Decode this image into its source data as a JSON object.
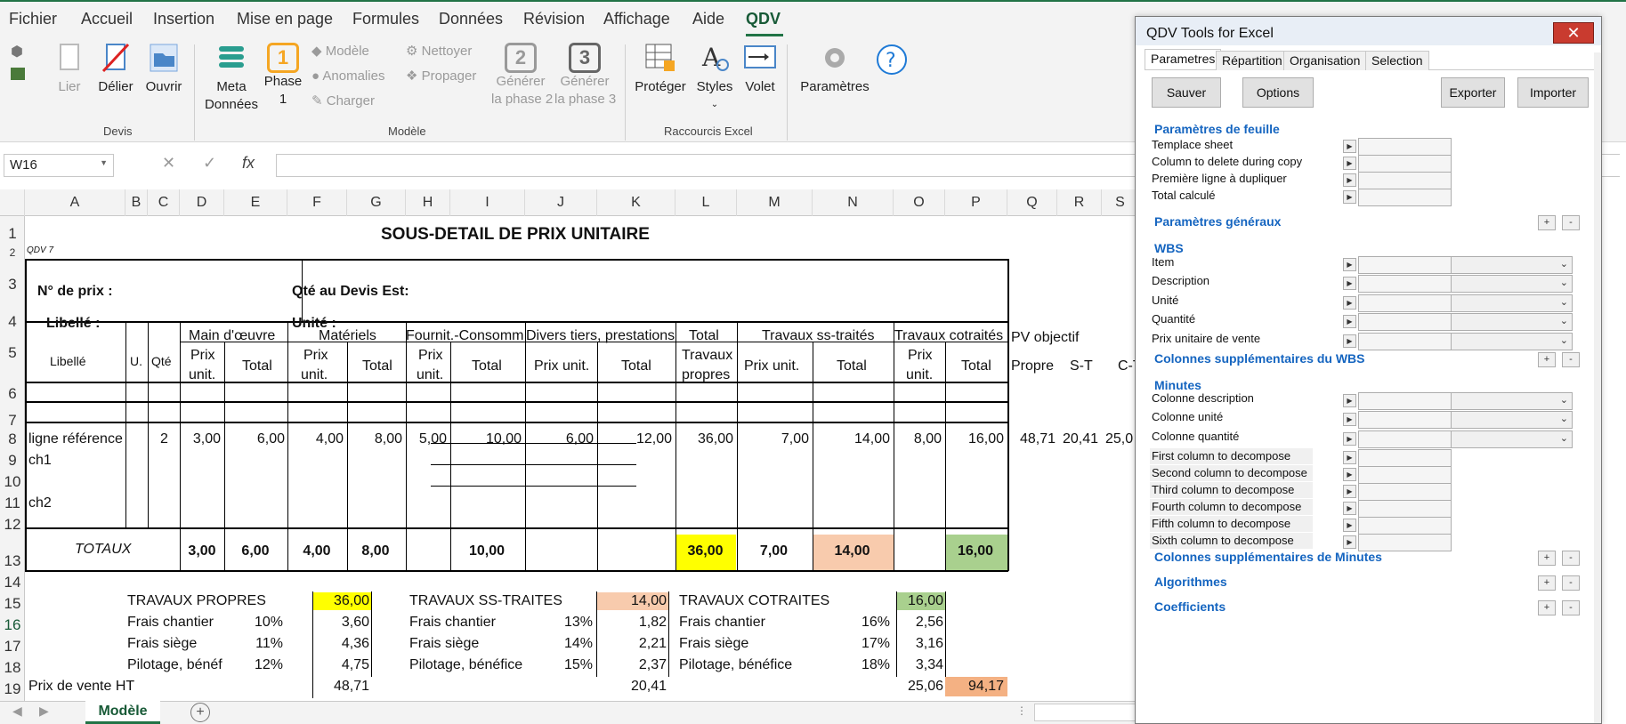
{
  "menu": {
    "items": [
      "Fichier",
      "Accueil",
      "Insertion",
      "Mise en page",
      "Formules",
      "Données",
      "Révision",
      "Affichage",
      "Aide",
      "QDV"
    ],
    "active": "QDV"
  },
  "ribbon": {
    "devis": {
      "lier": "Lier",
      "delier": "Délier",
      "ouvrir": "Ouvrir",
      "group": "Devis"
    },
    "modele": {
      "meta1": "Meta",
      "meta2": "Données",
      "phase1a": "Phase",
      "phase1b": "1",
      "phase_num1": "1",
      "modele": "Modèle",
      "anomalies": "Anomalies",
      "charger": "Charger",
      "nettoyer": "Nettoyer",
      "propager": "Propager",
      "gen2a": "Générer",
      "gen2b": "la phase 2",
      "gen3a": "Générer",
      "gen3b": "la phase 3",
      "phase_num2": "2",
      "phase_num3": "3",
      "group": "Modèle"
    },
    "raccourcis": {
      "proteger": "Protéger",
      "styles": "Styles",
      "volet": "Volet",
      "group": "Raccourcis Excel"
    },
    "parametres": "Paramètres"
  },
  "formula_bar": {
    "namebox": "W16",
    "fx": "fx",
    "value": ""
  },
  "columns": [
    "A",
    "B",
    "C",
    "D",
    "E",
    "F",
    "G",
    "H",
    "I",
    "J",
    "K",
    "L",
    "M",
    "N",
    "O",
    "P",
    "Q",
    "R",
    "S"
  ],
  "rows": [
    "1",
    "2",
    "3",
    "4",
    "5",
    "6",
    "7",
    "8",
    "9",
    "10",
    "11",
    "12",
    "13",
    "14",
    "15",
    "16",
    "17",
    "18",
    "19"
  ],
  "sheet": {
    "title": "SOUS-DETAIL DE PRIX UNITAIRE",
    "qdv": "QDV 7",
    "n_prix": "N° de prix :",
    "qte_devis": "Qté au Devis Est:",
    "libelle_lbl": "Libellé :",
    "unite_lbl": "Unité :",
    "h_libelle": "Libellé",
    "h_u": "U.",
    "h_qte": "Qté",
    "h_mo": "Main d'œuvre",
    "h_mat": "Matériels",
    "h_fourn": "Fournit.-Consomm",
    "h_divers": "Divers tiers, prestations",
    "h_total1": "Total",
    "h_total2": "Travaux",
    "h_total3": "propres",
    "h_sst": "Travaux ss-traités",
    "h_cot": "Travaux cotraités",
    "h_pv": "PV objectif",
    "h_prix": "Prix",
    "h_unit": "unit.",
    "h_total": "Total",
    "h_prixunit": "Prix unit.",
    "h_propre": "Propre",
    "h_st": "S-T",
    "h_ct": "C-T",
    "row8": [
      "ligne référence",
      "2",
      "3,00",
      "6,00",
      "4,00",
      "8,00",
      "5,00",
      "10,00",
      "6,00",
      "12,00",
      "36,00",
      "7,00",
      "14,00",
      "8,00",
      "16,00",
      "48,71",
      "20,41",
      "25,0"
    ],
    "ch1": "ch1",
    "ch2": "ch2",
    "totaux": [
      "TOTAUX",
      "3,00",
      "6,00",
      "4,00",
      "8,00",
      "10,00",
      "36,00",
      "7,00",
      "14,00",
      "16,00"
    ],
    "tp": {
      "title": "TRAVAUX PROPRES",
      "val": "36,00",
      "fc": "Frais chantier",
      "fc_p": "10%",
      "fc_v": "3,60",
      "fs": "Frais siège",
      "fs_p": "11%",
      "fs_v": "4,36",
      "pb": "Pilotage, bénéf",
      "pb_p": "12%",
      "pb_v": "4,75",
      "pv": "48,71"
    },
    "st": {
      "title": "TRAVAUX SS-TRAITES",
      "val": "14,00",
      "fc": "Frais chantier",
      "fc_p": "13%",
      "fc_v": "1,82",
      "fs": "Frais siège",
      "fs_p": "14%",
      "fs_v": "2,21",
      "pb": "Pilotage, bénéfice",
      "pb_p": "15%",
      "pb_v": "2,37",
      "pv": "20,41"
    },
    "ct": {
      "title": "TRAVAUX COTRAITES",
      "val": "16,00",
      "fc": "Frais chantier",
      "fc_p": "16%",
      "fc_v": "2,56",
      "fs": "Frais siège",
      "fs_p": "17%",
      "fs_v": "3,16",
      "pb": "Pilotage, bénéfice",
      "pb_p": "18%",
      "pb_v": "3,34",
      "pv": "25,06"
    },
    "prix_vente": "Prix de vente HT",
    "total_pv": "94,17"
  },
  "sheet_tab": "Modèle",
  "colors": {
    "yellow": "#ffff00",
    "salmon": "#f8cbad",
    "green": "#a9d08e",
    "orange": "#f4b183",
    "accent": "#217346",
    "link_blue": "#1565c0"
  },
  "panel": {
    "title": "QDV Tools for Excel",
    "tabs": [
      "Parametres",
      "Répartition",
      "Organisation",
      "Selection"
    ],
    "buttons": {
      "sauver": "Sauver",
      "options": "Options",
      "exporter": "Exporter",
      "importer": "Importer"
    },
    "sec_feuille": "Paramètres de feuille",
    "feuille": [
      "Templace sheet",
      "Column to delete during copy",
      "Première ligne à dupliquer",
      "Total calculé"
    ],
    "sec_generaux": "Paramètres généraux",
    "sec_wbs": "WBS",
    "wbs": [
      "Item",
      "Description",
      "Unité",
      "Quantité",
      "Prix unitaire de vente"
    ],
    "sec_cols_wbs": "Colonnes supplémentaires du WBS",
    "sec_minutes": "Minutes",
    "minutes": [
      "Colonne description",
      "Colonne unité",
      "Colonne quantité"
    ],
    "decompose": [
      "First column to decompose",
      "Second column to decompose",
      "Third column to decompose",
      "Fourth column to decompose",
      "Fifth column to decompose",
      "Sixth column to decompose"
    ],
    "sec_cols_min": "Colonnes supplémentaires de Minutes",
    "sec_algo": "Algorithmes",
    "sec_coef": "Coefficients",
    "plus": "+",
    "minus": "-"
  }
}
